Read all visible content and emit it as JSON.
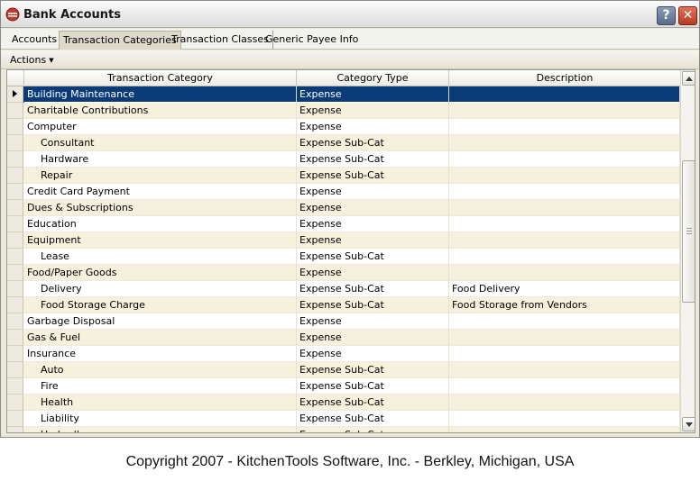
{
  "window": {
    "title": "Bank Accounts",
    "help_label": "?",
    "close_label": "✕"
  },
  "tabs": [
    {
      "label": "Accounts",
      "active": false
    },
    {
      "label": "Transaction Categories",
      "active": true
    },
    {
      "label": "Transaction Classes",
      "active": false
    },
    {
      "label": "Generic Payee Info",
      "active": false
    }
  ],
  "actions": {
    "label": "Actions"
  },
  "grid": {
    "columns": [
      "Transaction Category",
      "Category Type",
      "Description"
    ],
    "rows": [
      {
        "category": "Building Maintenance",
        "type": "Expense",
        "description": "",
        "sub": false,
        "selected": true
      },
      {
        "category": "Charitable Contributions",
        "type": "Expense",
        "description": "",
        "sub": false
      },
      {
        "category": "Computer",
        "type": "Expense",
        "description": "",
        "sub": false
      },
      {
        "category": "Consultant",
        "type": "Expense Sub-Cat",
        "description": "",
        "sub": true
      },
      {
        "category": "Hardware",
        "type": "Expense Sub-Cat",
        "description": "",
        "sub": true
      },
      {
        "category": "Repair",
        "type": "Expense Sub-Cat",
        "description": "",
        "sub": true
      },
      {
        "category": "Credit Card Payment",
        "type": "Expense",
        "description": "",
        "sub": false
      },
      {
        "category": "Dues & Subscriptions",
        "type": "Expense",
        "description": "",
        "sub": false
      },
      {
        "category": "Education",
        "type": "Expense",
        "description": "",
        "sub": false
      },
      {
        "category": "Equipment",
        "type": "Expense",
        "description": "",
        "sub": false
      },
      {
        "category": "Lease",
        "type": "Expense Sub-Cat",
        "description": "",
        "sub": true
      },
      {
        "category": "Food/Paper Goods",
        "type": "Expense",
        "description": "",
        "sub": false
      },
      {
        "category": "Delivery",
        "type": "Expense Sub-Cat",
        "description": "Food Delivery",
        "sub": true
      },
      {
        "category": "Food Storage Charge",
        "type": "Expense Sub-Cat",
        "description": "Food Storage from Vendors",
        "sub": true
      },
      {
        "category": "Garbage Disposal",
        "type": "Expense",
        "description": "",
        "sub": false
      },
      {
        "category": "Gas & Fuel",
        "type": "Expense",
        "description": "",
        "sub": false
      },
      {
        "category": "Insurance",
        "type": "Expense",
        "description": "",
        "sub": false
      },
      {
        "category": "Auto",
        "type": "Expense Sub-Cat",
        "description": "",
        "sub": true
      },
      {
        "category": "Fire",
        "type": "Expense Sub-Cat",
        "description": "",
        "sub": true
      },
      {
        "category": "Health",
        "type": "Expense Sub-Cat",
        "description": "",
        "sub": true
      },
      {
        "category": "Liability",
        "type": "Expense Sub-Cat",
        "description": "",
        "sub": true
      },
      {
        "category": "Umbrella",
        "type": "Expense Sub-Cat",
        "description": "",
        "sub": true
      }
    ]
  },
  "footer": {
    "text": "Copyright 2007 - KitchenTools Software, Inc. - Berkley, Michigan, USA"
  },
  "colors": {
    "selected_row": "#0a3b76",
    "alt_row": "#f5f1dc",
    "close_button": "#c84a30"
  }
}
